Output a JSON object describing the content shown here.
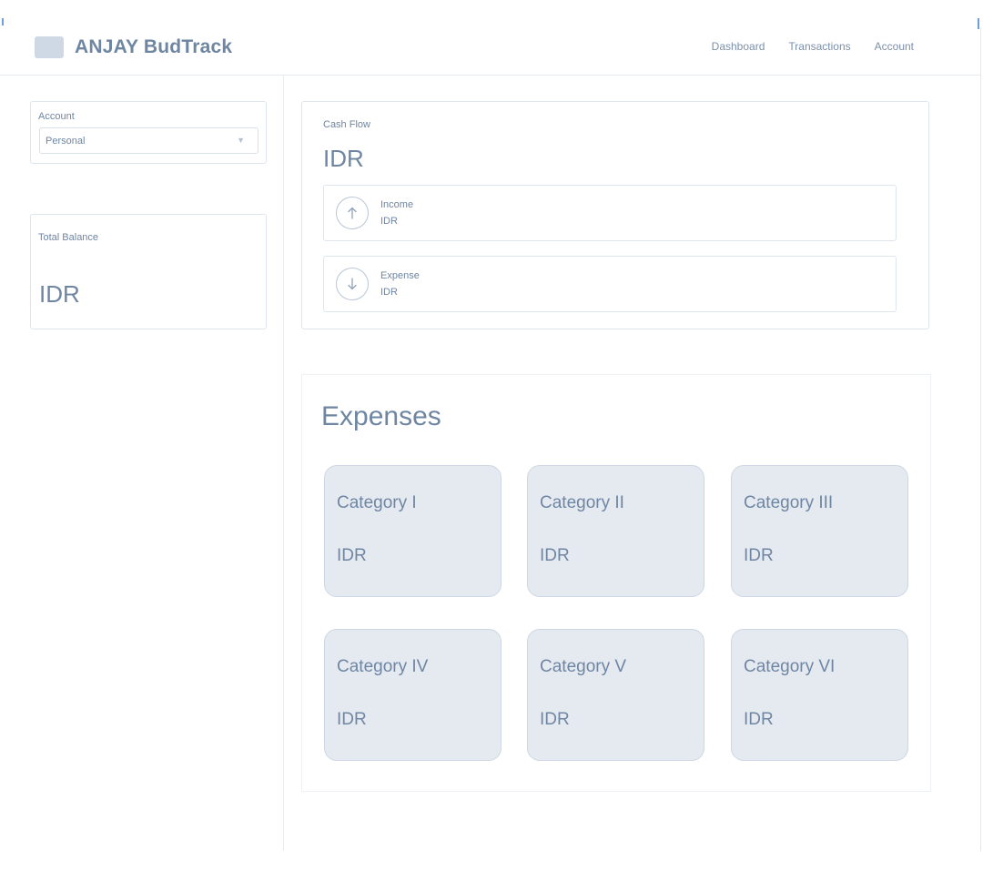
{
  "app": {
    "brand": "ANJAY BudTrack"
  },
  "nav": {
    "items": [
      "Dashboard",
      "Transactions",
      "Account"
    ]
  },
  "sidebar": {
    "account": {
      "label": "Account",
      "selected": "Personal"
    },
    "total_balance": {
      "label": "Total Balance",
      "value": "IDR"
    }
  },
  "cash_flow": {
    "label": "Cash Flow",
    "value": "IDR",
    "income": {
      "label": "Income",
      "value": "IDR",
      "icon": "arrow-up-icon"
    },
    "expense": {
      "label": "Expense",
      "value": "IDR",
      "icon": "arrow-down-icon"
    }
  },
  "expenses": {
    "title": "Expenses",
    "categories": [
      {
        "name": "Category I",
        "value": "IDR"
      },
      {
        "name": "Category II",
        "value": "IDR"
      },
      {
        "name": "Category III",
        "value": "IDR"
      },
      {
        "name": "Category IV",
        "value": "IDR"
      },
      {
        "name": "Category V",
        "value": "IDR"
      },
      {
        "name": "Category VI",
        "value": "IDR"
      }
    ]
  },
  "colors": {
    "text": "#6f86a3",
    "card_border": "#dfe5ee",
    "category_bg": "#e5eaf1",
    "logo": "#cfd9e6"
  }
}
